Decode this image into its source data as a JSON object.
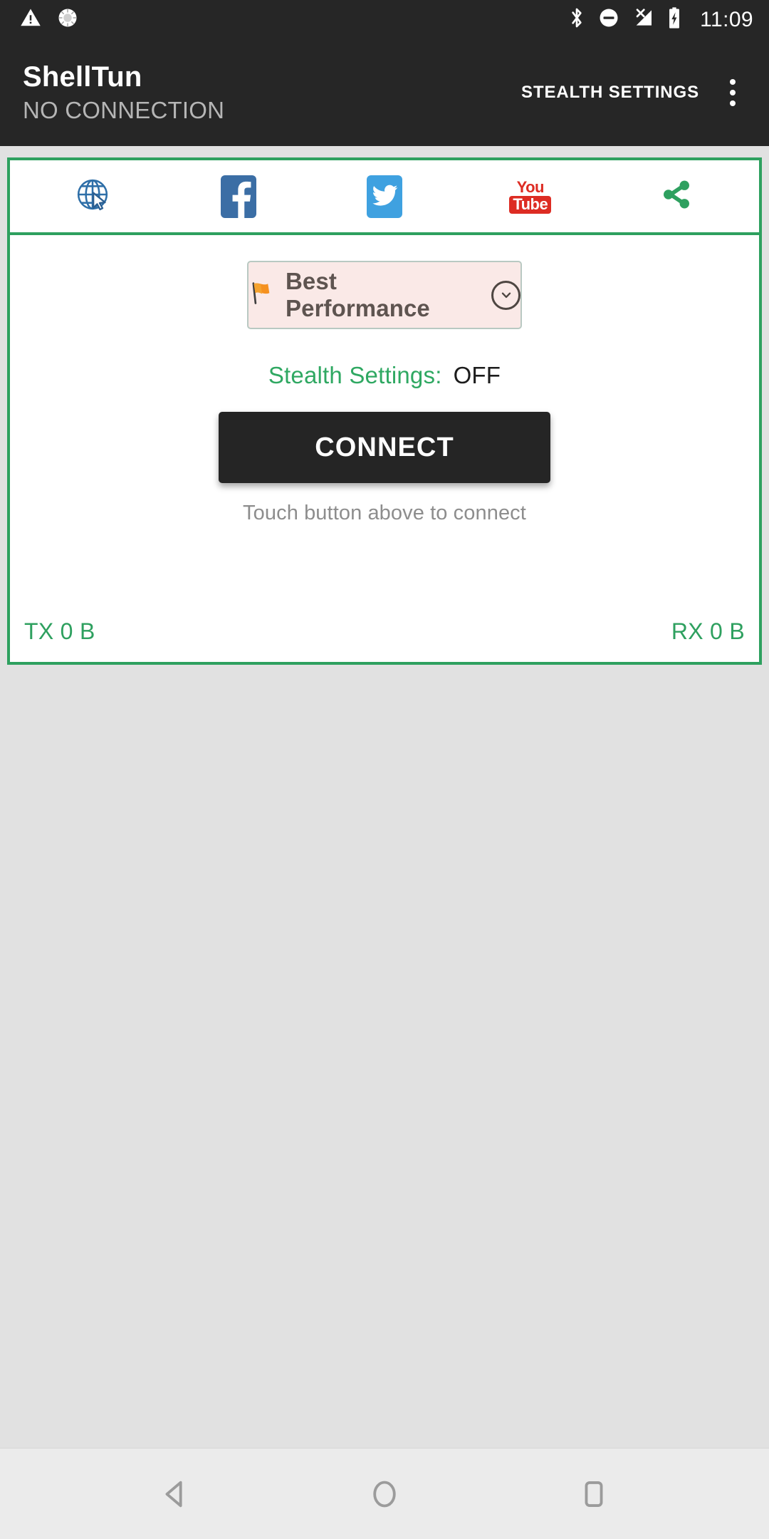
{
  "status_bar": {
    "time": "11:09",
    "left_icons": [
      {
        "name": "warning-triangle-icon"
      },
      {
        "name": "spinner-icon"
      }
    ],
    "right_icons": [
      {
        "name": "bluetooth-icon"
      },
      {
        "name": "do-not-disturb-icon"
      },
      {
        "name": "no-signal-icon"
      },
      {
        "name": "battery-charging-icon"
      }
    ]
  },
  "app_bar": {
    "title": "ShellTun",
    "subtitle": "NO CONNECTION",
    "stealth_settings_action": "STEALTH SETTINGS",
    "overflow_menu": "overflow-menu-icon"
  },
  "social_row": {
    "items": [
      {
        "name": "globe-browser-icon",
        "label": "Web"
      },
      {
        "name": "facebook-icon",
        "label": "Facebook"
      },
      {
        "name": "twitter-icon",
        "label": "Twitter"
      },
      {
        "name": "youtube-icon",
        "label_top": "You",
        "label_bottom": "Tube"
      },
      {
        "name": "share-icon",
        "label": "Share"
      }
    ]
  },
  "main": {
    "profile": {
      "flag": "🚩",
      "label": "Best Performance",
      "dropdown_icon": "chevron-down-icon"
    },
    "stealth": {
      "label": "Stealth Settings:",
      "value": "OFF"
    },
    "connect_button": "CONNECT",
    "connect_hint": "Touch button above to connect",
    "traffic": {
      "tx": "TX 0 B",
      "rx": "RX 0 B"
    }
  },
  "nav_bar": {
    "back": "back-triangle-icon",
    "home": "home-circle-icon",
    "recents": "recents-square-icon"
  },
  "colors": {
    "accent_green": "#2ea05f",
    "header_dark": "#262626",
    "page_background": "#e1e1e1",
    "profile_background": "#fae9e7",
    "facebook_blue": "#3b6ea5",
    "twitter_blue": "#3fa1e0",
    "youtube_red": "#dd2c23"
  }
}
